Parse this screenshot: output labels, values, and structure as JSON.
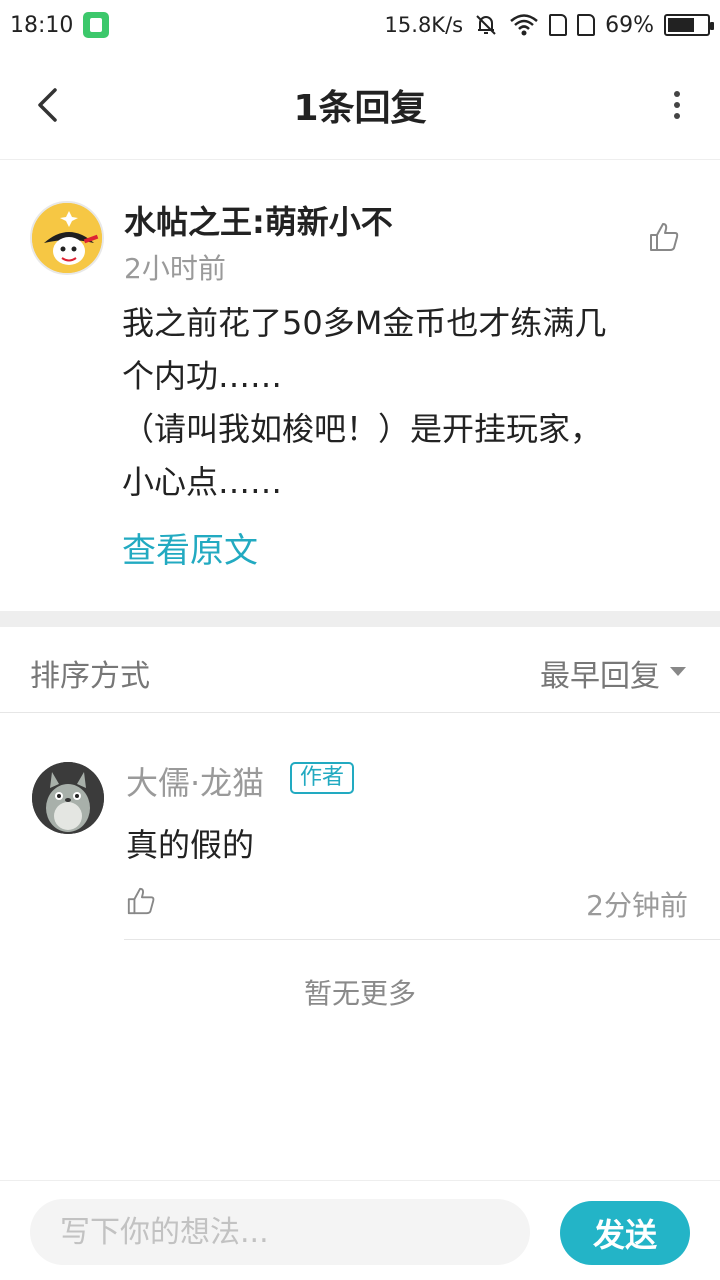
{
  "status_bar": {
    "time": "18:10",
    "net_speed": "15.8K/s",
    "battery_text": "69%",
    "battery_level": 0.69
  },
  "header": {
    "title": "1条回复"
  },
  "original_comment": {
    "username": "水帖之王:萌新小不",
    "time": "2小时前",
    "lines": [
      "我之前花了50多M金币也才练满几",
      "个内功……",
      "（请叫我如梭吧！）是开挂玩家，",
      "小心点……"
    ],
    "view_original": "查看原文"
  },
  "sort": {
    "label": "排序方式",
    "value": "最早回复"
  },
  "reply": {
    "username": "大儒·龙猫",
    "badge": "作者",
    "text": "真的假的",
    "time": "2分钟前"
  },
  "no_more": "暂无更多",
  "bottom_bar": {
    "placeholder": "写下你的想法...",
    "send_label": "发送"
  },
  "colors": {
    "accent": "#22aac1",
    "send_button": "#23b4c7",
    "secondary_text": "#9a9a9a"
  }
}
